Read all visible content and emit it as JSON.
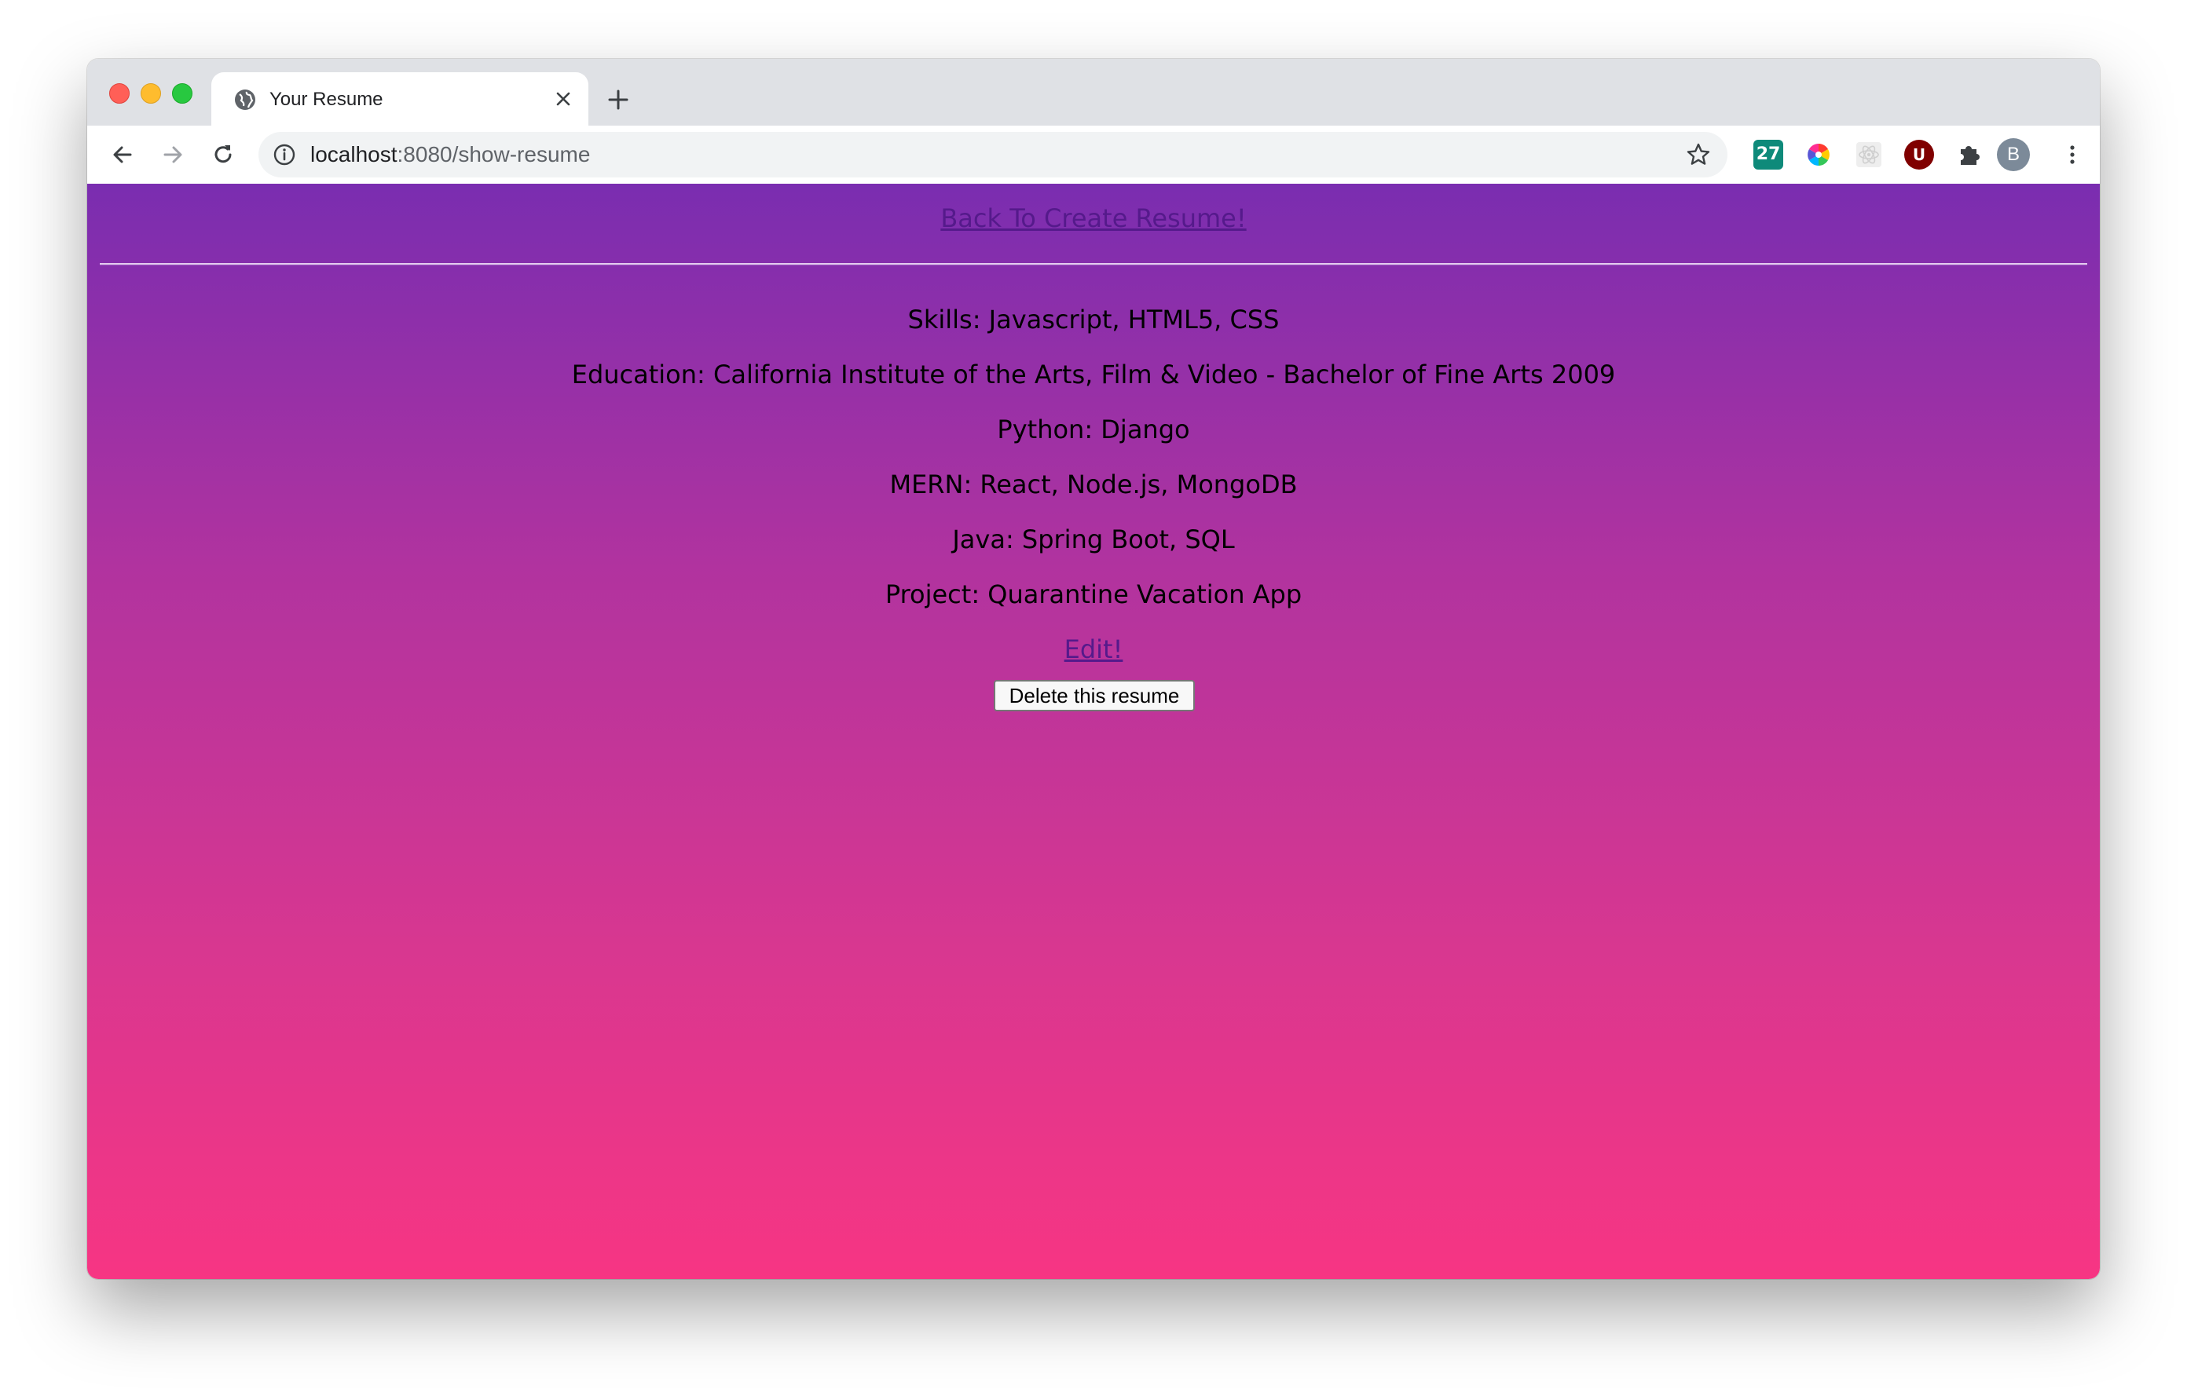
{
  "browser": {
    "tab": {
      "title": "Your Resume"
    },
    "address": {
      "host": "localhost",
      "path": ":8080/show-resume"
    },
    "extensions": [
      {
        "name": "calendar-27",
        "label": "27",
        "color": "#0e8a7a"
      },
      {
        "name": "color-wheel",
        "label": "",
        "color": "#ff5533"
      },
      {
        "name": "react-devtools",
        "label": "",
        "color": "#cccccc"
      },
      {
        "name": "ublock",
        "label": "U",
        "color": "#800000"
      }
    ],
    "profile": {
      "initial": "B"
    }
  },
  "page": {
    "back_link": "Back To Create Resume!",
    "lines": [
      "Skills: Javascript, HTML5, CSS",
      "Education: California Institute of the Arts, Film & Video - Bachelor of Fine Arts 2009",
      "Python: Django",
      "MERN: React, Node.js, MongoDB",
      "Java: Spring Boot, SQL",
      "Project: Quarantine Vacation App"
    ],
    "edit_link": "Edit!",
    "delete_button": "Delete this resume",
    "gradient": {
      "top": "#7a2db0",
      "bottom": "#f73583"
    },
    "link_color": "#551a8b"
  }
}
